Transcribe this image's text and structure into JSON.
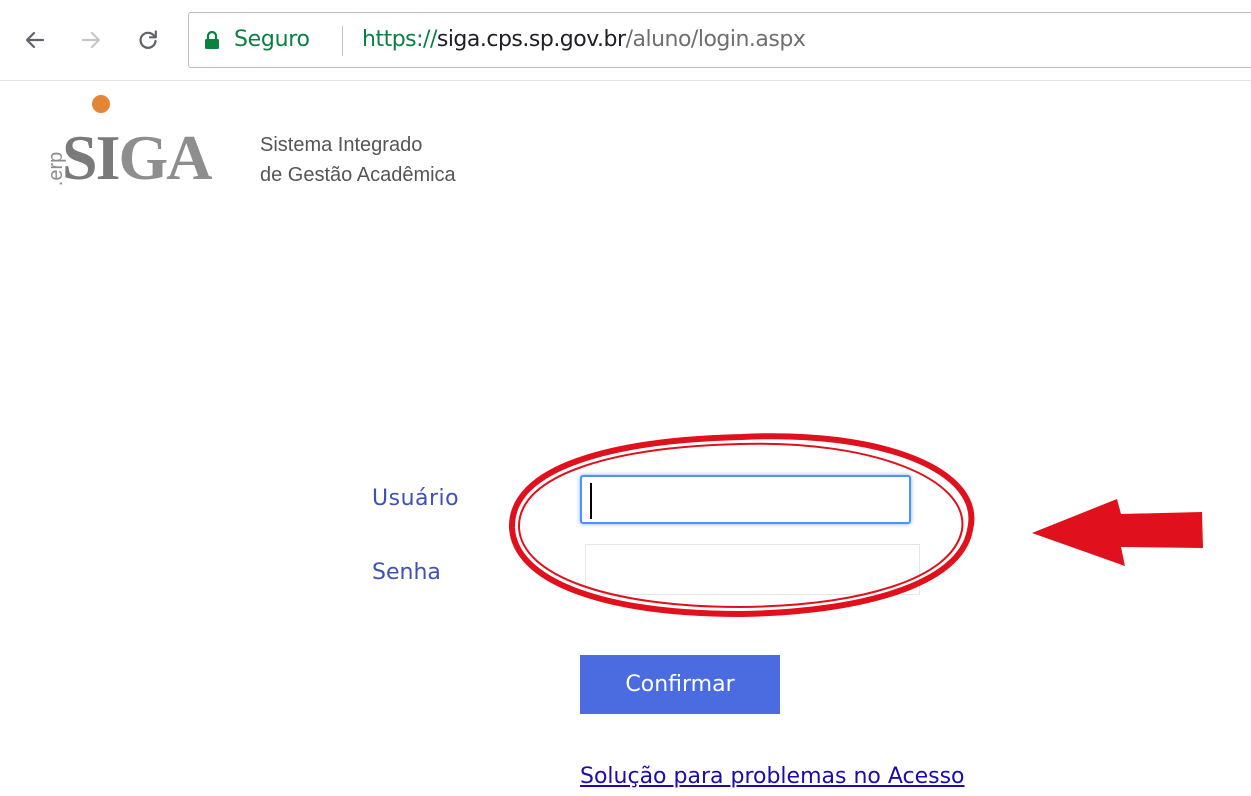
{
  "browser": {
    "security_label": "Seguro",
    "url": {
      "scheme": "https://",
      "host": "siga.cps.sp.gov.br",
      "path": "/aluno/login.aspx"
    }
  },
  "logo": {
    "prefix": ".erp",
    "word_si": "SI",
    "word_ga": "GA",
    "subtitle_line1": "Sistema Integrado",
    "subtitle_line2": "de Gestão Acadêmica"
  },
  "form": {
    "user_label": "Usuário",
    "user_value": "",
    "password_label": "Senha",
    "password_value": "",
    "confirm_label": "Confirmar",
    "help_link": "Solução para problemas no Acesso"
  },
  "colors": {
    "secure_green": "#0b8043",
    "label_blue": "#3f51b5",
    "button_blue": "#4b6be0",
    "annotation_red": "#e0101c",
    "logo_orange": "#e58636"
  },
  "icons": [
    "back-arrow-icon",
    "forward-arrow-icon",
    "reload-icon",
    "lock-icon"
  ]
}
